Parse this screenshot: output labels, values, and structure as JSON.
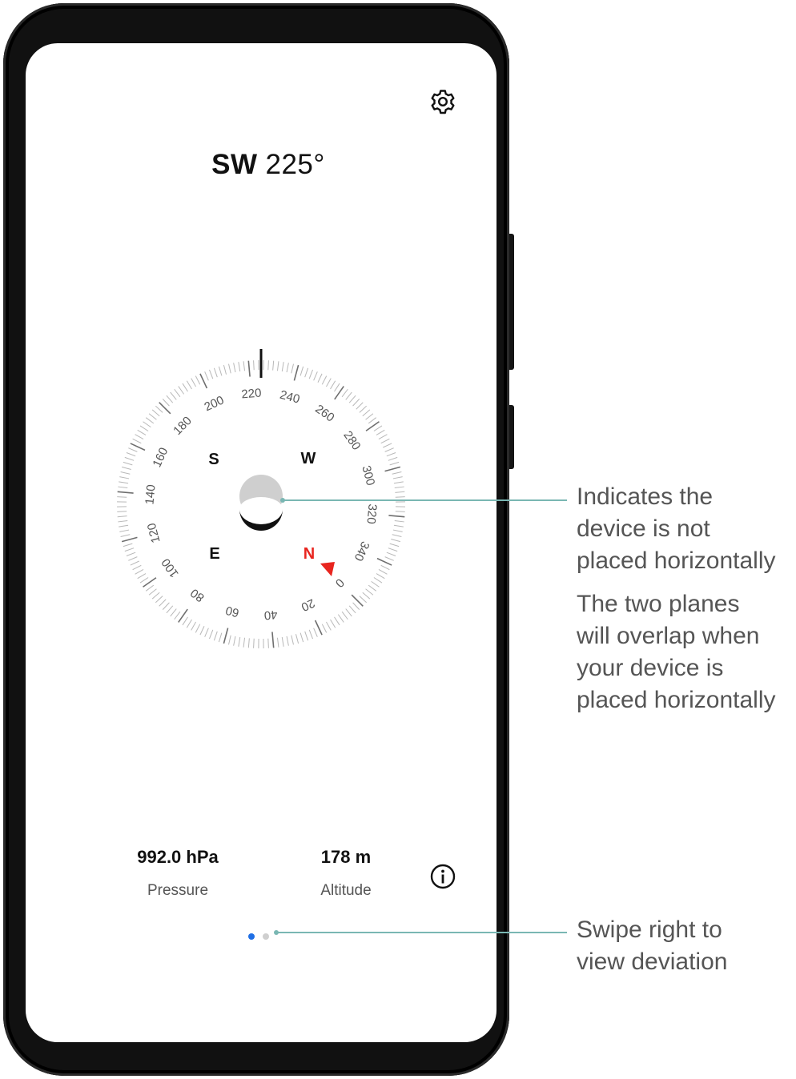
{
  "heading": {
    "direction": "SW",
    "degrees": "225°"
  },
  "compass": {
    "heading_degrees": 225,
    "cardinal_labels": [
      "N",
      "E",
      "S",
      "W"
    ],
    "ring_labels": [
      "0",
      "20",
      "40",
      "60",
      "80",
      "100",
      "120",
      "140",
      "160",
      "180",
      "200",
      "220",
      "240",
      "260",
      "280",
      "300",
      "320",
      "340"
    ],
    "accent_color": "#e8251f",
    "level_bubble": "tilted"
  },
  "stats": {
    "pressure": {
      "value": "992.0 hPa",
      "label": "Pressure"
    },
    "altitude": {
      "value": "178 m",
      "label": "Altitude"
    }
  },
  "icons": {
    "settings": "gear-icon",
    "info": "info-icon"
  },
  "pagination": {
    "total": 2,
    "active": 0,
    "active_color": "#1f6fe5",
    "inactive_color": "#cfcfcf"
  },
  "annotations": {
    "level": {
      "line1": "Indicates the",
      "line2": "device is not",
      "line3": "placed horizontally"
    },
    "planes": {
      "line1": "The two planes",
      "line2": "will overlap when",
      "line3": "your device is",
      "line4": "placed horizontally"
    },
    "swipe": {
      "line1": "Swipe right to",
      "line2": "view deviation"
    }
  }
}
